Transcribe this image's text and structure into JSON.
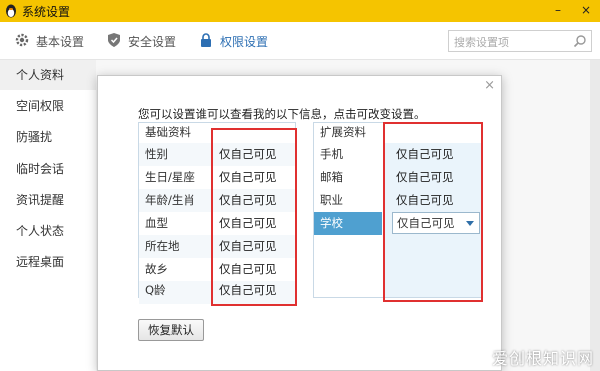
{
  "window": {
    "title": "系统设置",
    "minimize_glyph": "–",
    "close_glyph": "×"
  },
  "toolbar": {
    "tabs": [
      {
        "label": "基本设置",
        "icon": "gear-icon"
      },
      {
        "label": "安全设置",
        "icon": "shield-icon"
      },
      {
        "label": "权限设置",
        "icon": "lock-icon"
      }
    ],
    "search_placeholder": "搜索设置项"
  },
  "sidebar": {
    "items": [
      {
        "label": "个人资料"
      },
      {
        "label": "空间权限"
      },
      {
        "label": "防骚扰"
      },
      {
        "label": "临时会话"
      },
      {
        "label": "资讯提醒"
      },
      {
        "label": "个人状态"
      },
      {
        "label": "远程桌面"
      }
    ]
  },
  "dialog": {
    "close_glyph": "×",
    "instruction": "您可以设置谁可以查看我的以下信息，点击可改变设置。",
    "basic": {
      "header": "基础资料",
      "rows": [
        {
          "label": "性别",
          "value": "仅自己可见"
        },
        {
          "label": "生日/星座",
          "value": "仅自己可见"
        },
        {
          "label": "年龄/生肖",
          "value": "仅自己可见"
        },
        {
          "label": "血型",
          "value": "仅自己可见"
        },
        {
          "label": "所在地",
          "value": "仅自己可见"
        },
        {
          "label": "故乡",
          "value": "仅自己可见"
        },
        {
          "label": "Q龄",
          "value": "仅自己可见"
        }
      ]
    },
    "extended": {
      "header": "扩展资料",
      "rows": [
        {
          "label": "手机",
          "value": "仅自己可见"
        },
        {
          "label": "邮箱",
          "value": "仅自己可见"
        },
        {
          "label": "职业",
          "value": "仅自己可见"
        },
        {
          "label": "学校",
          "value": "仅自己可见"
        }
      ]
    },
    "restore_button": "恢复默认"
  },
  "watermark": "爱创根知识网",
  "colors": {
    "title_bar": "#f5c400",
    "accent": "#2d6fb3",
    "selected_row": "#4fa0d0",
    "highlight_box": "#e03030"
  }
}
